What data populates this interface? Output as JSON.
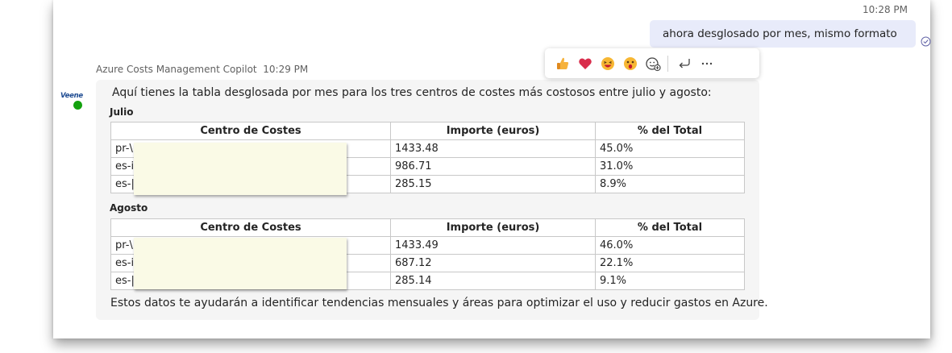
{
  "messages": {
    "user": {
      "time": "10:28 PM",
      "text": "ahora desglosado por mes, mismo formato"
    },
    "bot": {
      "sender": "Azure Costs Management Copilot",
      "time": "10:29 PM",
      "avatar_text": "Veene",
      "intro": "Aquí tienes la tabla desglosada por mes para los tres centros de costes más costosos entre julio y agosto:",
      "tables": [
        {
          "heading": "Julio",
          "columns": [
            "Centro de Costes",
            "Importe (euros)",
            "% del Total"
          ],
          "rows": [
            [
              "pr-\\",
              "1433.48",
              "45.0%"
            ],
            [
              "es-i",
              "986.71",
              "31.0%"
            ],
            [
              "es-|",
              "285.15",
              "8.9%"
            ]
          ]
        },
        {
          "heading": "Agosto",
          "columns": [
            "Centro de Costes",
            "Importe (euros)",
            "% del Total"
          ],
          "rows": [
            [
              "pr-\\",
              "1433.49",
              "46.0%"
            ],
            [
              "es-i",
              "687.12",
              "22.1%"
            ],
            [
              "es-|",
              "285.14",
              "9.1%"
            ]
          ]
        }
      ],
      "closing": "Estos datos te ayudarán a identificar tendencias mensuales y áreas para optimizar el uso y reducir gastos en Azure."
    }
  },
  "reactions": [
    "thumbs-up-icon",
    "heart-icon",
    "laughing-icon",
    "surprised-icon",
    "add-reaction-icon",
    "reply-icon",
    "more-options-icon"
  ],
  "colors": {
    "user_bubble": "#e8ebfa",
    "bot_bubble": "#f5f5f5",
    "presence_available": "#13a10e",
    "redaction": "#fafae6"
  }
}
